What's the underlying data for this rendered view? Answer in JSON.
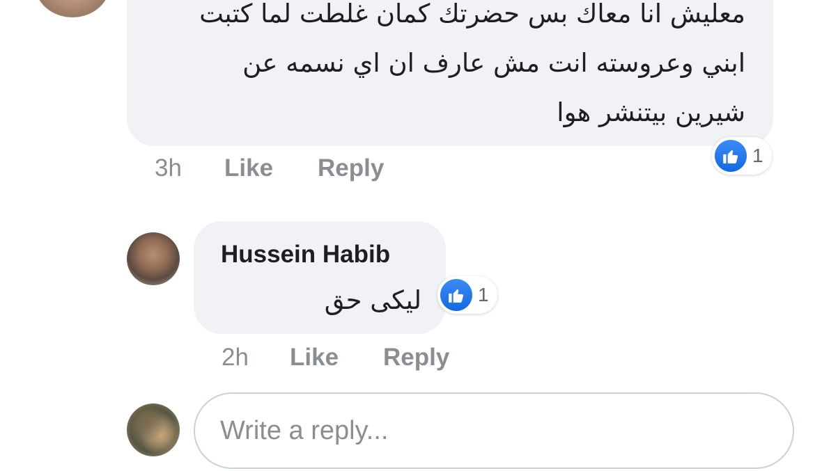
{
  "comments": [
    {
      "text_lines": [
        "معليش انا معاك بس حضرتك كمان غلطت لما كتبت",
        "ابني وعروسته انت مش عارف ان اي نسمه عن",
        "شيرين بيتنشر هوا"
      ],
      "reaction": {
        "icon": "thumbs-up-icon",
        "count": "1"
      },
      "time": "3h",
      "like_label": "Like",
      "reply_label": "Reply"
    },
    {
      "author": "Hussein Habib",
      "text": "ليكى حق",
      "reaction": {
        "icon": "thumbs-up-icon",
        "count": "1"
      },
      "time": "2h",
      "like_label": "Like",
      "reply_label": "Reply"
    }
  ],
  "reply_input": {
    "placeholder": "Write a reply..."
  },
  "colors": {
    "bubble": "#f0f2f5",
    "like_blue": "#1877f2",
    "meta_text": "#8a8d91"
  }
}
